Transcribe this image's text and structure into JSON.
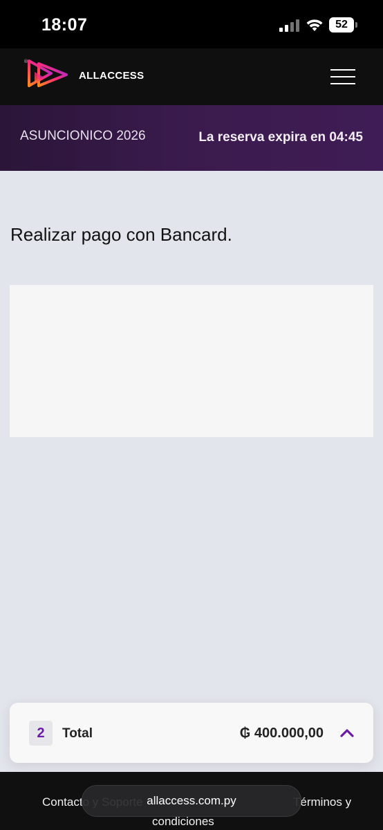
{
  "status_bar": {
    "time": "18:07",
    "battery": "52",
    "icons": [
      "signal-icon",
      "wifi-icon",
      "battery-icon"
    ]
  },
  "header": {
    "brand": "ALLACCESS",
    "logo_icon": "play-triangles-logo",
    "menu_icon": "hamburger-menu-icon"
  },
  "event": {
    "name": "ASUNCIONICO 2026",
    "timer_text": "La reserva expira en 04:45"
  },
  "main": {
    "heading": "Realizar pago con Bancard."
  },
  "summary": {
    "count": "2",
    "total_label": "Total",
    "amount": "₲ 400.000,00",
    "expand_icon": "chevron-up-icon"
  },
  "footer": {
    "contact": "Contacto y Soporte",
    "terms": "Términos y",
    "conditions": "condiciones",
    "url": "allaccess.com.py"
  },
  "colors": {
    "accent_purple": "#6a1aa8",
    "banner_bg": "#3b1b4e",
    "header_bg": "#0f0f10",
    "page_bg": "#e3e5ec"
  }
}
